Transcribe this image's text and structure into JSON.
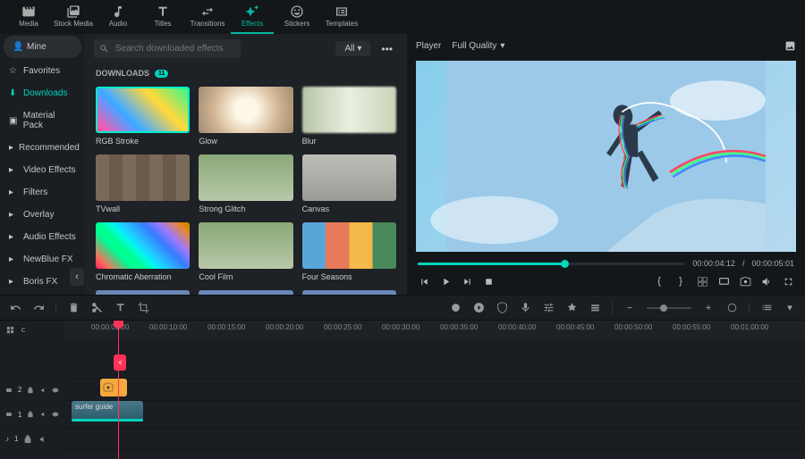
{
  "topTabs": [
    {
      "label": "Media",
      "icon": "media"
    },
    {
      "label": "Stock Media",
      "icon": "stock"
    },
    {
      "label": "Audio",
      "icon": "audio"
    },
    {
      "label": "Titles",
      "icon": "titles"
    },
    {
      "label": "Transitions",
      "icon": "transitions"
    },
    {
      "label": "Effects",
      "icon": "effects",
      "active": true
    },
    {
      "label": "Stickers",
      "icon": "stickers"
    },
    {
      "label": "Templates",
      "icon": "templates"
    }
  ],
  "sidebar": {
    "mine": "Mine",
    "favorites": "Favorites",
    "downloads": "Downloads",
    "materialPack": "Material Pack",
    "recommended": "Recommended",
    "videoEffects": "Video Effects",
    "filters": "Filters",
    "overlay": "Overlay",
    "audioEffects": "Audio Effects",
    "newblue": "NewBlue FX",
    "boris": "Boris FX"
  },
  "search": {
    "placeholder": "Search downloaded effects",
    "filter": "All",
    "dots": "•••"
  },
  "section": {
    "title": "DOWNLOADS",
    "count": "11"
  },
  "effects": [
    {
      "label": "RGB Stroke",
      "cls": "th-rgb",
      "selected": true
    },
    {
      "label": "Glow",
      "cls": "th-glow"
    },
    {
      "label": "Blur",
      "cls": "th-blur"
    },
    {
      "label": "TVwall",
      "cls": "th-tvwall"
    },
    {
      "label": "Strong Glitch",
      "cls": "th-glitch"
    },
    {
      "label": "Canvas",
      "cls": "th-canvas"
    },
    {
      "label": "Chromatic Aberration",
      "cls": "th-chrom"
    },
    {
      "label": "Cool Film",
      "cls": "th-cool"
    },
    {
      "label": "Four Seasons",
      "cls": "th-seasons"
    },
    {
      "label": "",
      "cls": "th-more"
    },
    {
      "label": "",
      "cls": "th-more"
    },
    {
      "label": "",
      "cls": "th-more"
    }
  ],
  "player": {
    "title": "Player",
    "quality": "Full Quality",
    "currentTime": "00:00:04:12",
    "sep": "/",
    "totalTime": "00:00:05:01"
  },
  "ruler": [
    "00:00:05:00",
    "00:00:10:00",
    "00:00:15:00",
    "00:00:20:00",
    "00:00:25:00",
    "00:00:30:00",
    "00:00:35:00",
    "00:00:40:00",
    "00:00:45:00",
    "00:00:50:00",
    "00:00:55:00",
    "00:01:00:00"
  ],
  "tracks": {
    "t2": "2",
    "t1": "1",
    "a1": "1"
  },
  "clipLabel": "surfer guide"
}
